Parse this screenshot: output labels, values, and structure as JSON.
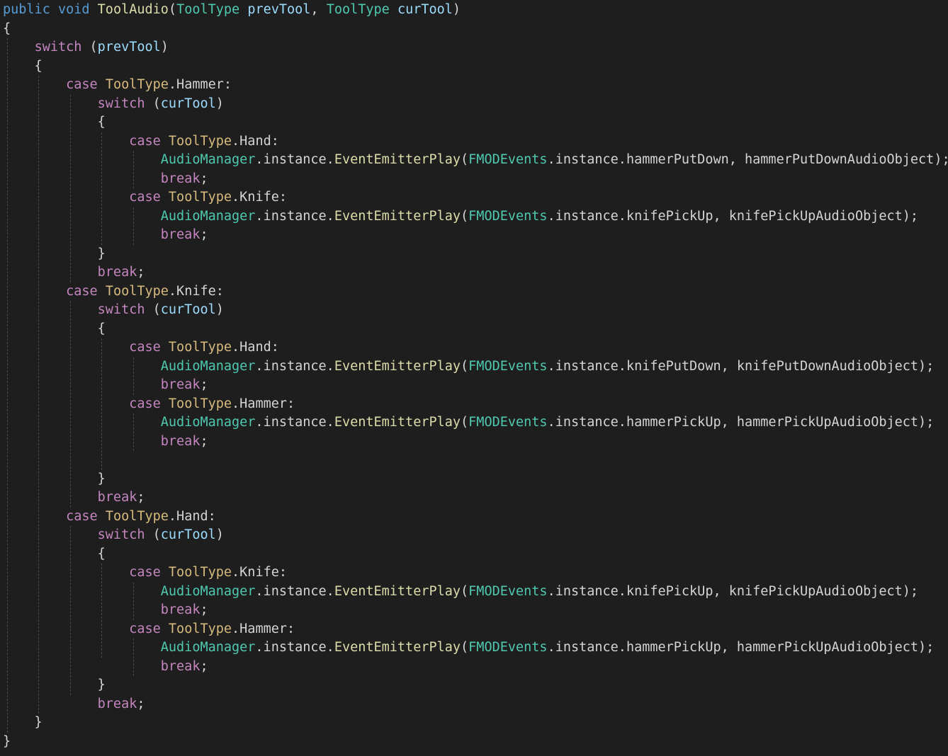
{
  "editor": {
    "background": "#1e1e1e",
    "colors": {
      "kw": "#569cd6",
      "ctl": "#c586c0",
      "type": "#4ec9b0",
      "fn": "#dcdcaa",
      "param": "#9cdcfe",
      "plain": "#d4d4d4",
      "case_type": "#d7ba7d"
    },
    "lines": [
      [
        [
          "kw",
          "public"
        ],
        [
          "plain",
          " "
        ],
        [
          "kw",
          "void"
        ],
        [
          "plain",
          " "
        ],
        [
          "fn",
          "ToolAudio"
        ],
        [
          "plain",
          "("
        ],
        [
          "type",
          "ToolType"
        ],
        [
          "plain",
          " "
        ],
        [
          "param",
          "prevTool"
        ],
        [
          "plain",
          ", "
        ],
        [
          "type",
          "ToolType"
        ],
        [
          "plain",
          " "
        ],
        [
          "param",
          "curTool"
        ],
        [
          "plain",
          ")"
        ]
      ],
      [
        [
          "plain",
          "{"
        ]
      ],
      [
        [
          "plain",
          "    "
        ],
        [
          "ctl",
          "switch"
        ],
        [
          "plain",
          " ("
        ],
        [
          "param",
          "prevTool"
        ],
        [
          "plain",
          ")"
        ]
      ],
      [
        [
          "plain",
          "    {"
        ]
      ],
      [
        [
          "plain",
          "        "
        ],
        [
          "ctl",
          "case"
        ],
        [
          "plain",
          " "
        ],
        [
          "case_type",
          "ToolType"
        ],
        [
          "plain",
          ".Hammer:"
        ]
      ],
      [
        [
          "plain",
          "            "
        ],
        [
          "ctl",
          "switch"
        ],
        [
          "plain",
          " ("
        ],
        [
          "param",
          "curTool"
        ],
        [
          "plain",
          ")"
        ]
      ],
      [
        [
          "plain",
          "            {"
        ]
      ],
      [
        [
          "plain",
          "                "
        ],
        [
          "ctl",
          "case"
        ],
        [
          "plain",
          " "
        ],
        [
          "case_type",
          "ToolType"
        ],
        [
          "plain",
          ".Hand:"
        ]
      ],
      [
        [
          "plain",
          "                    "
        ],
        [
          "type",
          "AudioManager"
        ],
        [
          "plain",
          ".instance."
        ],
        [
          "fn",
          "EventEmitterPlay"
        ],
        [
          "plain",
          "("
        ],
        [
          "type",
          "FMODEvents"
        ],
        [
          "plain",
          ".instance.hammerPutDown, hammerPutDownAudioObject);"
        ]
      ],
      [
        [
          "plain",
          "                    "
        ],
        [
          "ctl",
          "break"
        ],
        [
          "plain",
          ";"
        ]
      ],
      [
        [
          "plain",
          "                "
        ],
        [
          "ctl",
          "case"
        ],
        [
          "plain",
          " "
        ],
        [
          "case_type",
          "ToolType"
        ],
        [
          "plain",
          ".Knife:"
        ]
      ],
      [
        [
          "plain",
          "                    "
        ],
        [
          "type",
          "AudioManager"
        ],
        [
          "plain",
          ".instance."
        ],
        [
          "fn",
          "EventEmitterPlay"
        ],
        [
          "plain",
          "("
        ],
        [
          "type",
          "FMODEvents"
        ],
        [
          "plain",
          ".instance.knifePickUp, knifePickUpAudioObject);"
        ]
      ],
      [
        [
          "plain",
          "                    "
        ],
        [
          "ctl",
          "break"
        ],
        [
          "plain",
          ";"
        ]
      ],
      [
        [
          "plain",
          "            }"
        ]
      ],
      [
        [
          "plain",
          "            "
        ],
        [
          "ctl",
          "break"
        ],
        [
          "plain",
          ";"
        ]
      ],
      [
        [
          "plain",
          "        "
        ],
        [
          "ctl",
          "case"
        ],
        [
          "plain",
          " "
        ],
        [
          "case_type",
          "ToolType"
        ],
        [
          "plain",
          ".Knife:"
        ]
      ],
      [
        [
          "plain",
          "            "
        ],
        [
          "ctl",
          "switch"
        ],
        [
          "plain",
          " ("
        ],
        [
          "param",
          "curTool"
        ],
        [
          "plain",
          ")"
        ]
      ],
      [
        [
          "plain",
          "            {"
        ]
      ],
      [
        [
          "plain",
          "                "
        ],
        [
          "ctl",
          "case"
        ],
        [
          "plain",
          " "
        ],
        [
          "case_type",
          "ToolType"
        ],
        [
          "plain",
          ".Hand:"
        ]
      ],
      [
        [
          "plain",
          "                    "
        ],
        [
          "type",
          "AudioManager"
        ],
        [
          "plain",
          ".instance."
        ],
        [
          "fn",
          "EventEmitterPlay"
        ],
        [
          "plain",
          "("
        ],
        [
          "type",
          "FMODEvents"
        ],
        [
          "plain",
          ".instance.knifePutDown, knifePutDownAudioObject);"
        ]
      ],
      [
        [
          "plain",
          "                    "
        ],
        [
          "ctl",
          "break"
        ],
        [
          "plain",
          ";"
        ]
      ],
      [
        [
          "plain",
          "                "
        ],
        [
          "ctl",
          "case"
        ],
        [
          "plain",
          " "
        ],
        [
          "case_type",
          "ToolType"
        ],
        [
          "plain",
          ".Hammer:"
        ]
      ],
      [
        [
          "plain",
          "                    "
        ],
        [
          "type",
          "AudioManager"
        ],
        [
          "plain",
          ".instance."
        ],
        [
          "fn",
          "EventEmitterPlay"
        ],
        [
          "plain",
          "("
        ],
        [
          "type",
          "FMODEvents"
        ],
        [
          "plain",
          ".instance.hammerPickUp, hammerPickUpAudioObject);"
        ]
      ],
      [
        [
          "plain",
          "                    "
        ],
        [
          "ctl",
          "break"
        ],
        [
          "plain",
          ";"
        ]
      ],
      [],
      [
        [
          "plain",
          "            }"
        ]
      ],
      [
        [
          "plain",
          "            "
        ],
        [
          "ctl",
          "break"
        ],
        [
          "plain",
          ";"
        ]
      ],
      [
        [
          "plain",
          "        "
        ],
        [
          "ctl",
          "case"
        ],
        [
          "plain",
          " "
        ],
        [
          "case_type",
          "ToolType"
        ],
        [
          "plain",
          ".Hand:"
        ]
      ],
      [
        [
          "plain",
          "            "
        ],
        [
          "ctl",
          "switch"
        ],
        [
          "plain",
          " ("
        ],
        [
          "param",
          "curTool"
        ],
        [
          "plain",
          ")"
        ]
      ],
      [
        [
          "plain",
          "            {"
        ]
      ],
      [
        [
          "plain",
          "                "
        ],
        [
          "ctl",
          "case"
        ],
        [
          "plain",
          " "
        ],
        [
          "case_type",
          "ToolType"
        ],
        [
          "plain",
          ".Knife:"
        ]
      ],
      [
        [
          "plain",
          "                    "
        ],
        [
          "type",
          "AudioManager"
        ],
        [
          "plain",
          ".instance."
        ],
        [
          "fn",
          "EventEmitterPlay"
        ],
        [
          "plain",
          "("
        ],
        [
          "type",
          "FMODEvents"
        ],
        [
          "plain",
          ".instance.knifePickUp, knifePickUpAudioObject);"
        ]
      ],
      [
        [
          "plain",
          "                    "
        ],
        [
          "ctl",
          "break"
        ],
        [
          "plain",
          ";"
        ]
      ],
      [
        [
          "plain",
          "                "
        ],
        [
          "ctl",
          "case"
        ],
        [
          "plain",
          " "
        ],
        [
          "case_type",
          "ToolType"
        ],
        [
          "plain",
          ".Hammer:"
        ]
      ],
      [
        [
          "plain",
          "                    "
        ],
        [
          "type",
          "AudioManager"
        ],
        [
          "plain",
          ".instance."
        ],
        [
          "fn",
          "EventEmitterPlay"
        ],
        [
          "plain",
          "("
        ],
        [
          "type",
          "FMODEvents"
        ],
        [
          "plain",
          ".instance.hammerPickUp, hammerPickUpAudioObject);"
        ]
      ],
      [
        [
          "plain",
          "                    "
        ],
        [
          "ctl",
          "break"
        ],
        [
          "plain",
          ";"
        ]
      ],
      [
        [
          "plain",
          "            }"
        ]
      ],
      [
        [
          "plain",
          "            "
        ],
        [
          "ctl",
          "break"
        ],
        [
          "plain",
          ";"
        ]
      ],
      [
        [
          "plain",
          "    }"
        ]
      ],
      [
        [
          "plain",
          "}"
        ]
      ]
    ]
  }
}
